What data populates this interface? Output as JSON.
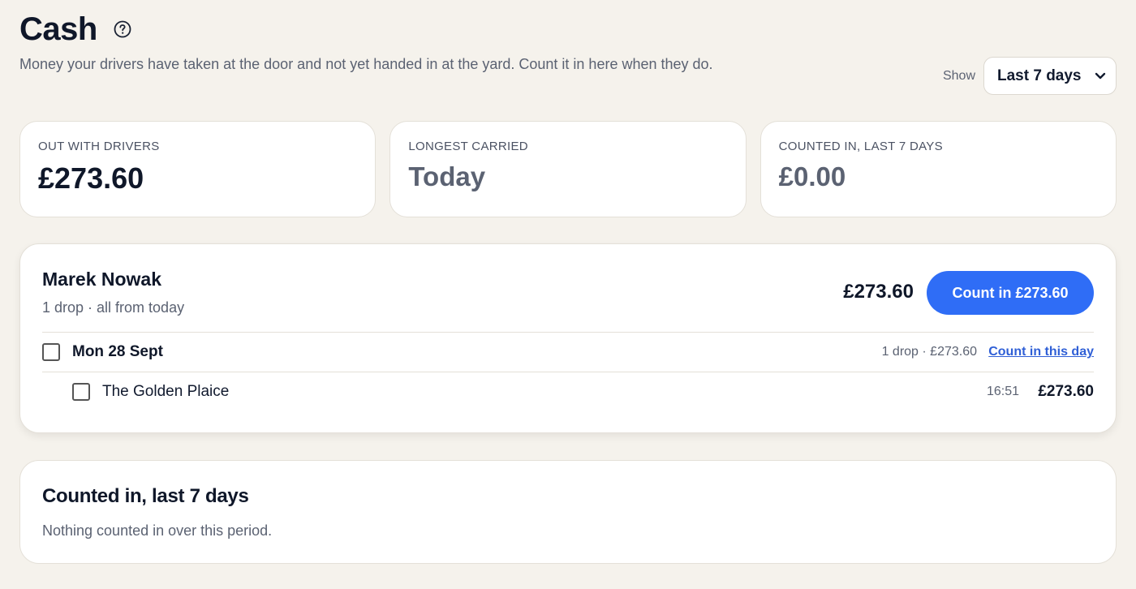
{
  "header": {
    "title": "Cash",
    "help_icon": "help-circle-icon",
    "subtitle": "Money your drivers have taken at the door and not yet handed in at the yard. Count it in here when they do.",
    "show_label": "Show",
    "period_selected": "Last 7 days",
    "period_icon": "chevron-down-icon"
  },
  "stats": [
    {
      "label": "OUT WITH DRIVERS",
      "value": "£273.60"
    },
    {
      "label": "LONGEST CARRIED",
      "value": "Today"
    },
    {
      "label": "COUNTED IN, LAST 7 DAYS",
      "value": "£0.00"
    }
  ],
  "driver": {
    "name": "Marek Nowak",
    "summary": "1 drop · all from today",
    "total": "£273.60",
    "count_button": "Count in £273.60",
    "days": [
      {
        "label": "Mon 28 Sept",
        "meta": "1 drop · £273.60",
        "link": "Count in this day",
        "drops": [
          {
            "name": "The Golden Plaice",
            "time": "16:51",
            "amount": "£273.60"
          }
        ]
      }
    ]
  },
  "counted": {
    "title": "Counted in, last 7 days",
    "empty": "Nothing counted in over this period."
  },
  "colors": {
    "background": "#f5f2ec",
    "accent": "#2f6df6",
    "link": "#2f5fd6"
  }
}
